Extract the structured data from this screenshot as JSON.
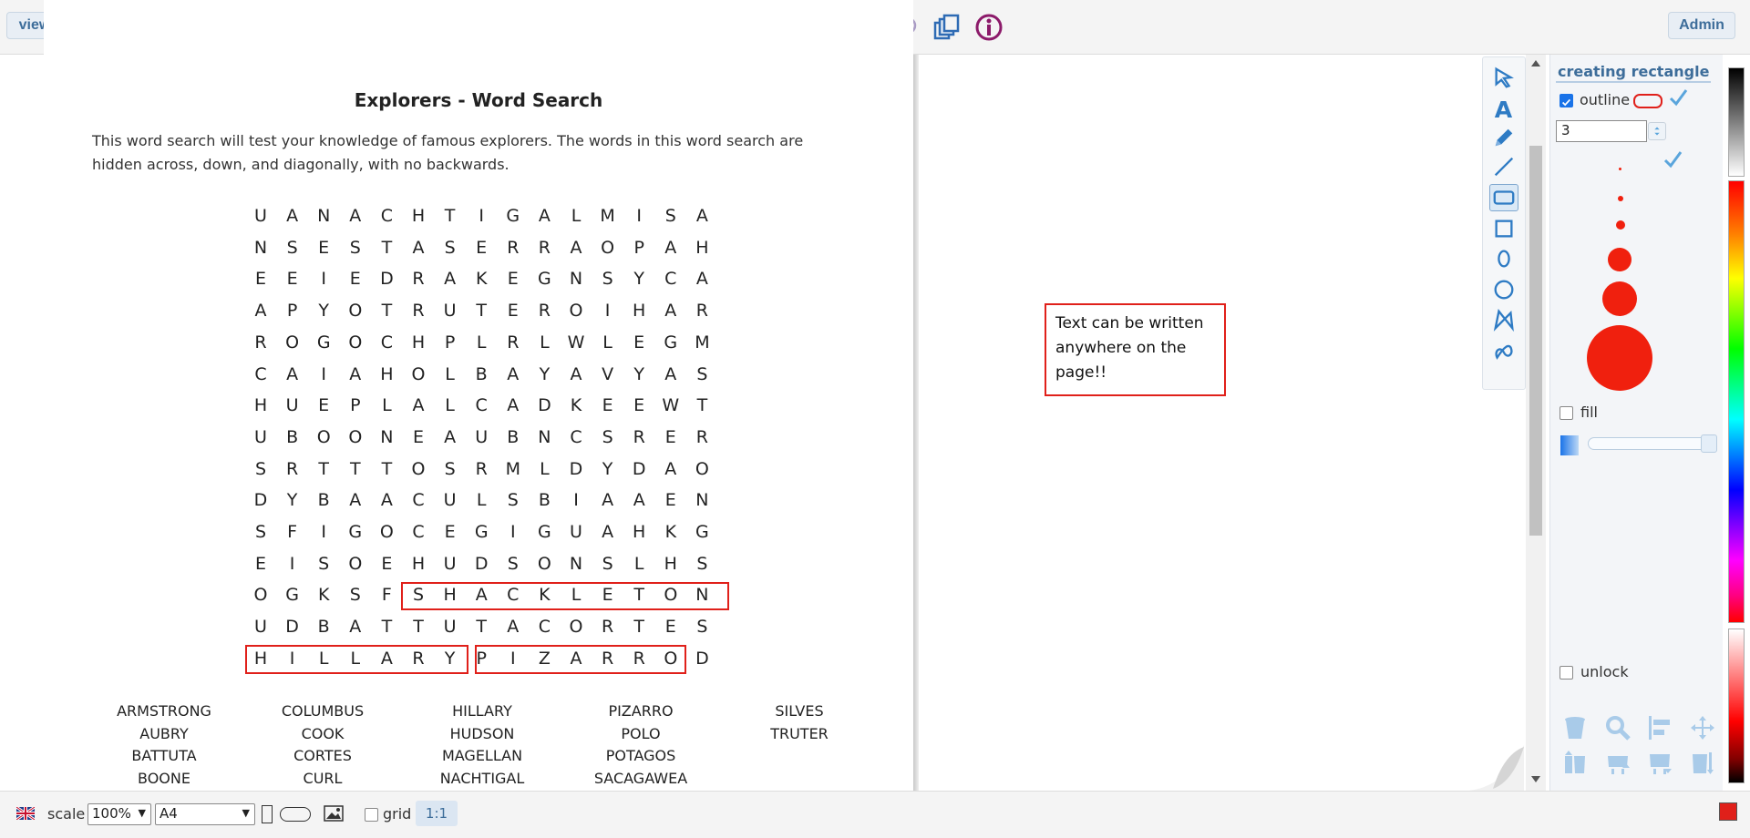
{
  "toolbar": {
    "view_label": "view",
    "admin_label": "Admin",
    "icons": [
      "document-icon",
      "open-folder-icon",
      "save-icon",
      "clear-icon",
      "print-icon",
      "undo-icon",
      "redo-icon",
      "cut-icon",
      "copy-icon",
      "paste-icon",
      "portrait-icon",
      "image-icon",
      "word-icon",
      "math-icon",
      "textbox-icon",
      "palette-icon",
      "table-icon",
      "chart-icon",
      "shapes-icon",
      "speech-bubble-icon",
      "duplicate-icon",
      "info-icon"
    ]
  },
  "document": {
    "title": "Explorers - Word Search",
    "description": "This word search will test your knowledge of famous explorers. The words in this word search are hidden across, down, and diagonally, with no backwards.",
    "grid_rows": [
      "UANACHTIGALMISA",
      "NSESTASERRAOPAH",
      "EEIEDRAKEGNSYCA",
      "APYOTRUTEROIHAR",
      "ROGOCHPLRLWLEGM",
      "CAIAHOLBAYAVYAS",
      "HUEPLALCADKEEWT",
      "UBOONEAUBNCSRER",
      "SRTTTOSRMLDYDAO",
      "DYBAACULSBIAAEN",
      "SFIGOCEGIGUAHKG",
      "EISOEHUDSONSLHS",
      "OGKSFSHACKLETON",
      "UDBATTUTACORTES",
      "HILLARYPIZARROD"
    ],
    "found_words": [
      "SHACKLETON",
      "HILLARY",
      "PIZARRO"
    ],
    "word_list": [
      [
        "ARMSTRONG",
        "AUBRY",
        "BATTUTA",
        "BOONE"
      ],
      [
        "COLUMBUS",
        "COOK",
        "CORTES",
        "CURL"
      ],
      [
        "HILLARY",
        "HUDSON",
        "MAGELLAN",
        "NACHTIGAL"
      ],
      [
        "PIZARRO",
        "POLO",
        "POTAGOS",
        "SACAGAWEA"
      ],
      [
        "SILVES",
        "TRUTER"
      ]
    ]
  },
  "note": {
    "lines": [
      "Text can be written",
      "anywhere on the",
      "page!!"
    ]
  },
  "tools": [
    "select-arrow-icon",
    "text-tool-icon",
    "pencil-icon",
    "line-icon",
    "rounded-rectangle-icon",
    "rectangle-icon",
    "ellipse-icon",
    "circle-icon",
    "freeform-shape-icon",
    "curve-icon"
  ],
  "properties": {
    "title": "creating rectangle",
    "outline_label": "outline",
    "outline_checked": true,
    "line_width": "3",
    "fill_label": "fill",
    "fill_checked": false,
    "unlock_label": "unlock",
    "unlock_checked": false,
    "accent_color": "#f0200e"
  },
  "status": {
    "scale_label": "scale",
    "zoom_value": "100%",
    "page_size": "A4",
    "grid_label": "grid",
    "ratio_label": "1:1",
    "current_color": "#e0201a"
  }
}
